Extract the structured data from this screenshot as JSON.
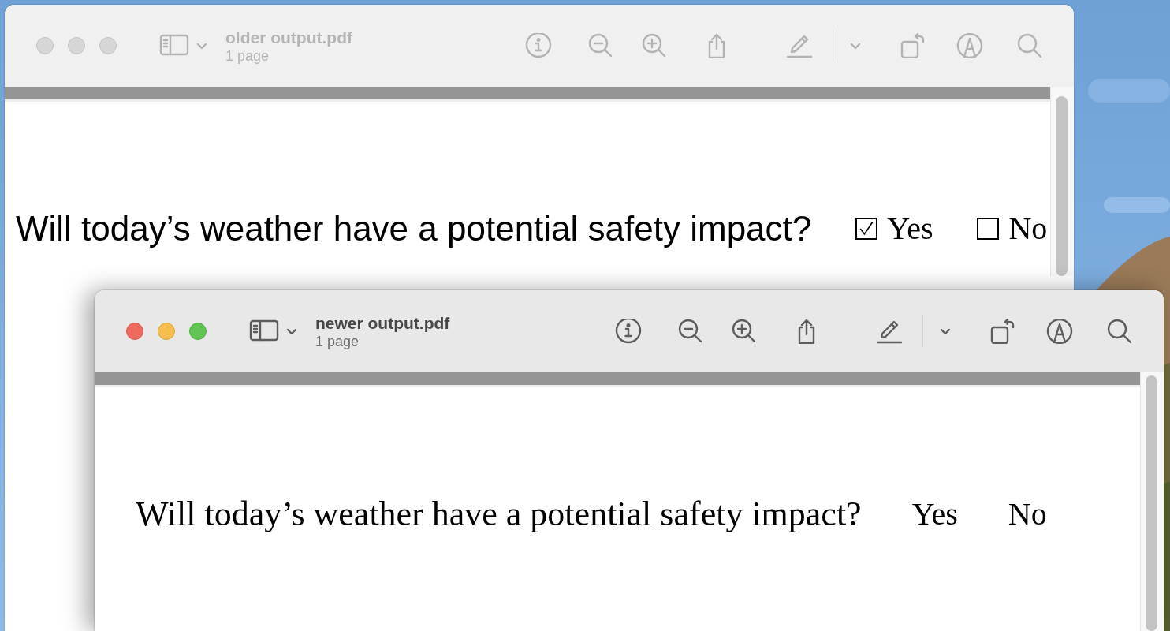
{
  "windows": [
    {
      "title": "older output.pdf",
      "subtitle": "1 page",
      "active": false,
      "document": {
        "kind": "form",
        "question": "Will today’s weather have a potential safety impact?",
        "options": [
          {
            "label": "Yes",
            "checked": true
          },
          {
            "label": "No",
            "checked": false
          }
        ]
      }
    },
    {
      "title": "newer output.pdf",
      "subtitle": "1 page",
      "active": true,
      "document": {
        "kind": "text",
        "question": "Will today’s weather have a potential safety impact?",
        "options": [
          {
            "label": "Yes"
          },
          {
            "label": "No"
          }
        ]
      }
    }
  ]
}
